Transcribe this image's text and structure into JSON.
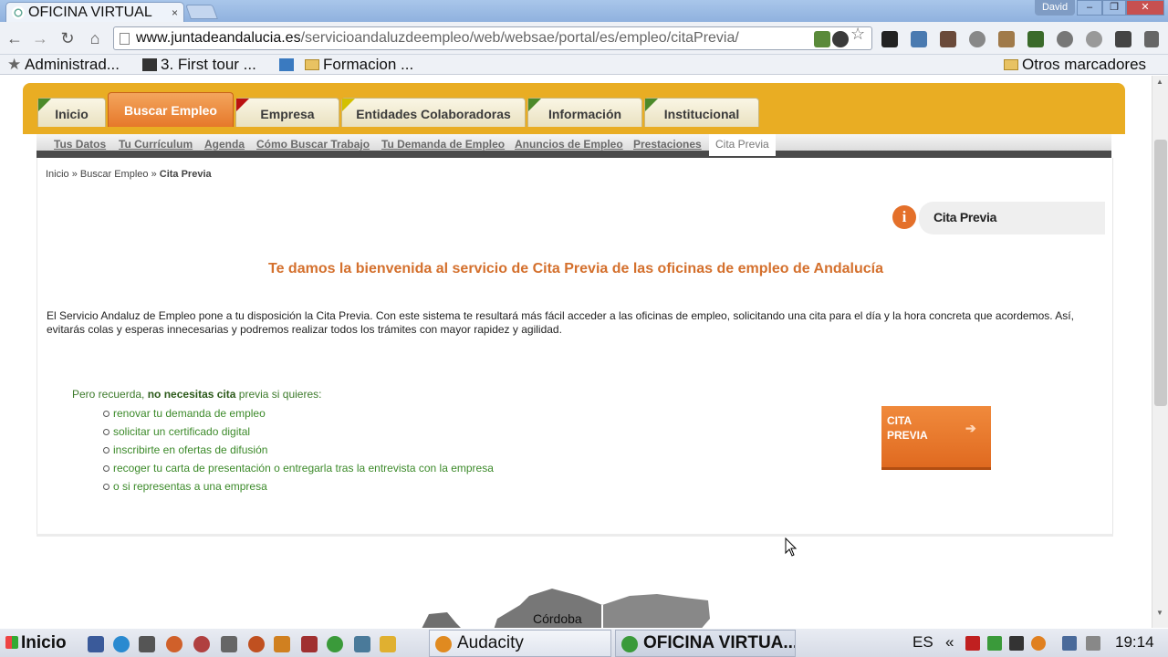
{
  "browser": {
    "tab_title": "OFICINA VIRTUAL",
    "tab_close": "×",
    "user": "David",
    "window_controls": [
      "–",
      "❐",
      "✕"
    ],
    "url_host": "www.juntadeandalucia.es",
    "url_path": "/servicioandaluzdeempleo/web/websae/portal/es/empleo/citaPrevia/",
    "nav_icons": [
      "back-icon",
      "forward-icon",
      "reload-icon",
      "home-icon"
    ],
    "bookmarks": [
      "Administrad...",
      "3. First tour ...",
      "Formacion ..."
    ],
    "other_bookmarks": "Otros marcadores"
  },
  "site": {
    "main_tabs": [
      "Inicio",
      "Buscar Empleo",
      "Empresa",
      "Entidades Colaboradoras",
      "Información",
      "Institucional"
    ],
    "sub_nav": [
      "Tus Datos",
      "Tu Currículum",
      "Agenda",
      "Cómo Buscar Trabajo",
      "Tu Demanda de Empleo",
      "Anuncios de Empleo",
      "Prestaciones",
      "Cita Previa"
    ],
    "breadcrumb": {
      "inicio": "Inicio",
      "sep1": " » ",
      "buscar": "Buscar Empleo",
      "sep2": " » ",
      "current": "Cita Previa"
    },
    "info_icon": "i",
    "info_title": "Cita Previa",
    "welcome": "Te damos la bienvenida al servicio de Cita Previa de las oficinas de empleo de Andalucía",
    "intro": "El Servicio Andaluz de Empleo pone a tu disposición la Cita Previa. Con este sistema te resultará más fácil acceder a las oficinas de empleo, solicitando una cita para el día y la hora concreta que acordemos. Así, evitarás colas y esperas innecesarias y podremos realizar todos los trámites con mayor rapidez y agilidad.",
    "recuerda_pre": "Pero recuerda, ",
    "recuerda_bold": "no necesitas cita",
    "recuerda_post": " previa si quieres:",
    "list": [
      "renovar tu demanda de empleo",
      "solicitar un certificado digital",
      "inscribirte en ofertas de difusión",
      "recoger tu carta de presentación o entregarla tras la entrevista con la empresa",
      "o si representas a una empresa"
    ],
    "cita_button": [
      "CITA",
      "PREVIA"
    ],
    "cita_arrow": "➔",
    "map_label": "Córdoba"
  },
  "taskbar": {
    "start": "Inicio",
    "windows": [
      "Audacity",
      "OFICINA VIRTUA..."
    ],
    "lang": "ES",
    "tray_chevron": "«",
    "clock": "19:14"
  },
  "colors": {
    "accent_orange": "#e9ad23",
    "active_tab": "#e6782a",
    "heading": "#d4702d",
    "list_green": "#3c8a2a"
  }
}
